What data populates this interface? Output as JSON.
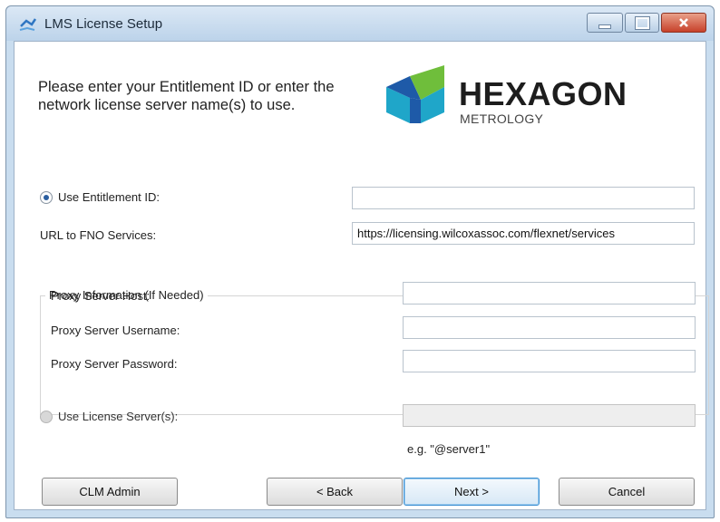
{
  "window": {
    "title": "LMS License Setup",
    "icon": "app-icon",
    "controls": {
      "minimize": "minimize-icon",
      "maximize": "maximize-icon",
      "close": "close-icon"
    }
  },
  "intro_text": "Please enter your Entitlement ID or enter the network license server name(s) to use.",
  "logo": {
    "word": "HEXAGON",
    "sub": "METROLOGY"
  },
  "entitlement": {
    "radio_label": "Use Entitlement ID:",
    "selected": true,
    "value": ""
  },
  "fno": {
    "label": "URL to FNO Services:",
    "value": "https://licensing.wilcoxassoc.com/flexnet/services"
  },
  "proxy": {
    "group_title": "Proxy Information (If Needed)",
    "host_label": "Proxy Server Host:",
    "host_value": "",
    "username_label": "Proxy Server Username:",
    "username_value": "",
    "password_label": "Proxy Server Password:",
    "password_value": ""
  },
  "license_server": {
    "radio_label": "Use License Server(s):",
    "selected": false,
    "value": "",
    "hint": "e.g. \"@server1\""
  },
  "buttons": {
    "clm_admin": "CLM Admin",
    "back": "< Back",
    "next": "Next >",
    "cancel": "Cancel"
  },
  "colors": {
    "title_bar": "#c9ddef",
    "close_button": "#c7412a",
    "logo_teal": "#1fa6c9",
    "logo_green": "#6fbe3b",
    "logo_blue": "#1e5aa8"
  }
}
